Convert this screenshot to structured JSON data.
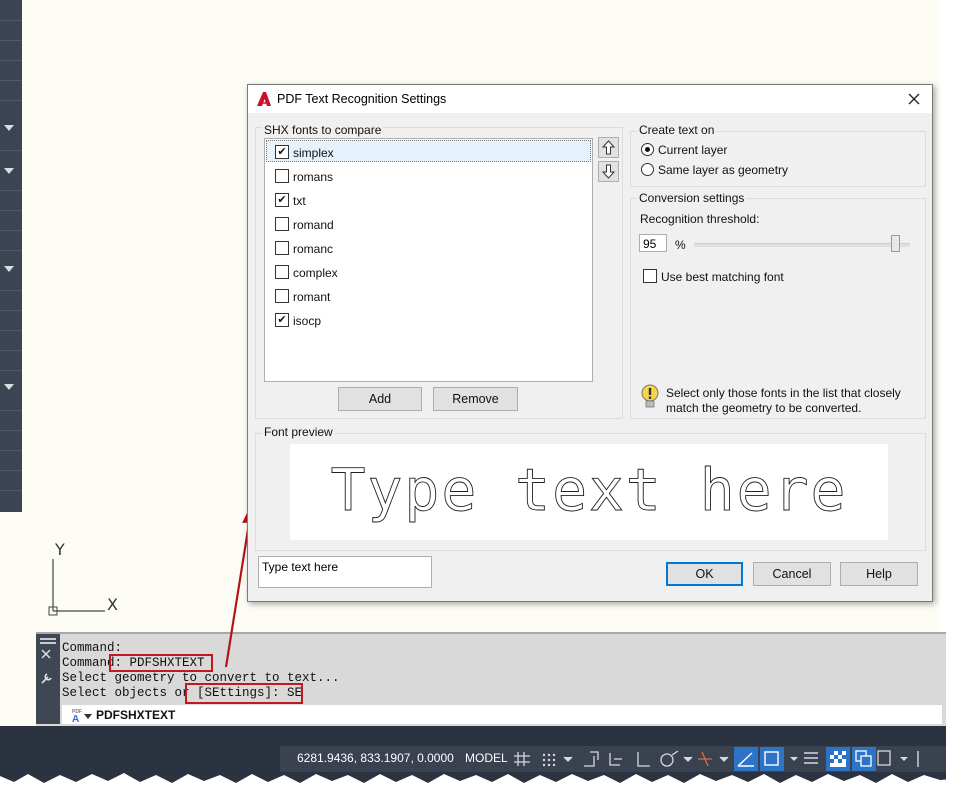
{
  "ucs": {
    "y_label": "Y",
    "x_label": "X"
  },
  "dialog": {
    "title": "PDF Text Recognition Settings",
    "shx_group_label": "SHX fonts to compare",
    "fonts": [
      {
        "name": "simplex",
        "checked": true
      },
      {
        "name": "romans",
        "checked": false
      },
      {
        "name": "txt",
        "checked": true
      },
      {
        "name": "romand",
        "checked": false
      },
      {
        "name": "romanc",
        "checked": false
      },
      {
        "name": "complex",
        "checked": false
      },
      {
        "name": "romant",
        "checked": false
      },
      {
        "name": "isocp",
        "checked": true
      }
    ],
    "add_label": "Add",
    "remove_label": "Remove",
    "create_text_label": "Create text on",
    "radio_current": "Current layer",
    "radio_same": "Same layer as geometry",
    "conversion_label": "Conversion settings",
    "threshold_label": "Recognition threshold:",
    "threshold_value": "95",
    "percent": "%",
    "threshold_fraction": 0.95,
    "best_match_label": "Use best matching font",
    "tip_line1": "Select only those fonts in the list that closely",
    "tip_line2": "match the geometry to be converted.",
    "font_preview_label": "Font preview",
    "preview_text": "Type text here",
    "preview_input_value": "Type text here",
    "ok_label": "OK",
    "cancel_label": "Cancel",
    "help_label": "Help"
  },
  "command": {
    "line1": "Command:",
    "line2_prefix": "Command",
    "line2_cmd": ": PDFSHXTEXT",
    "line3": "Select geometry to convert to text...",
    "line4_prefix": "Select objects or ",
    "line4_option": "[SEttings]: SE",
    "input_text": "PDFSHXTEXT"
  },
  "status": {
    "coords": "6281.9436, 833.1907, 0.0000",
    "model": "MODEL"
  },
  "colors": {
    "accent": "#0078d7",
    "annotation_red": "#c0191f",
    "autocad_red": "#c8102e"
  }
}
